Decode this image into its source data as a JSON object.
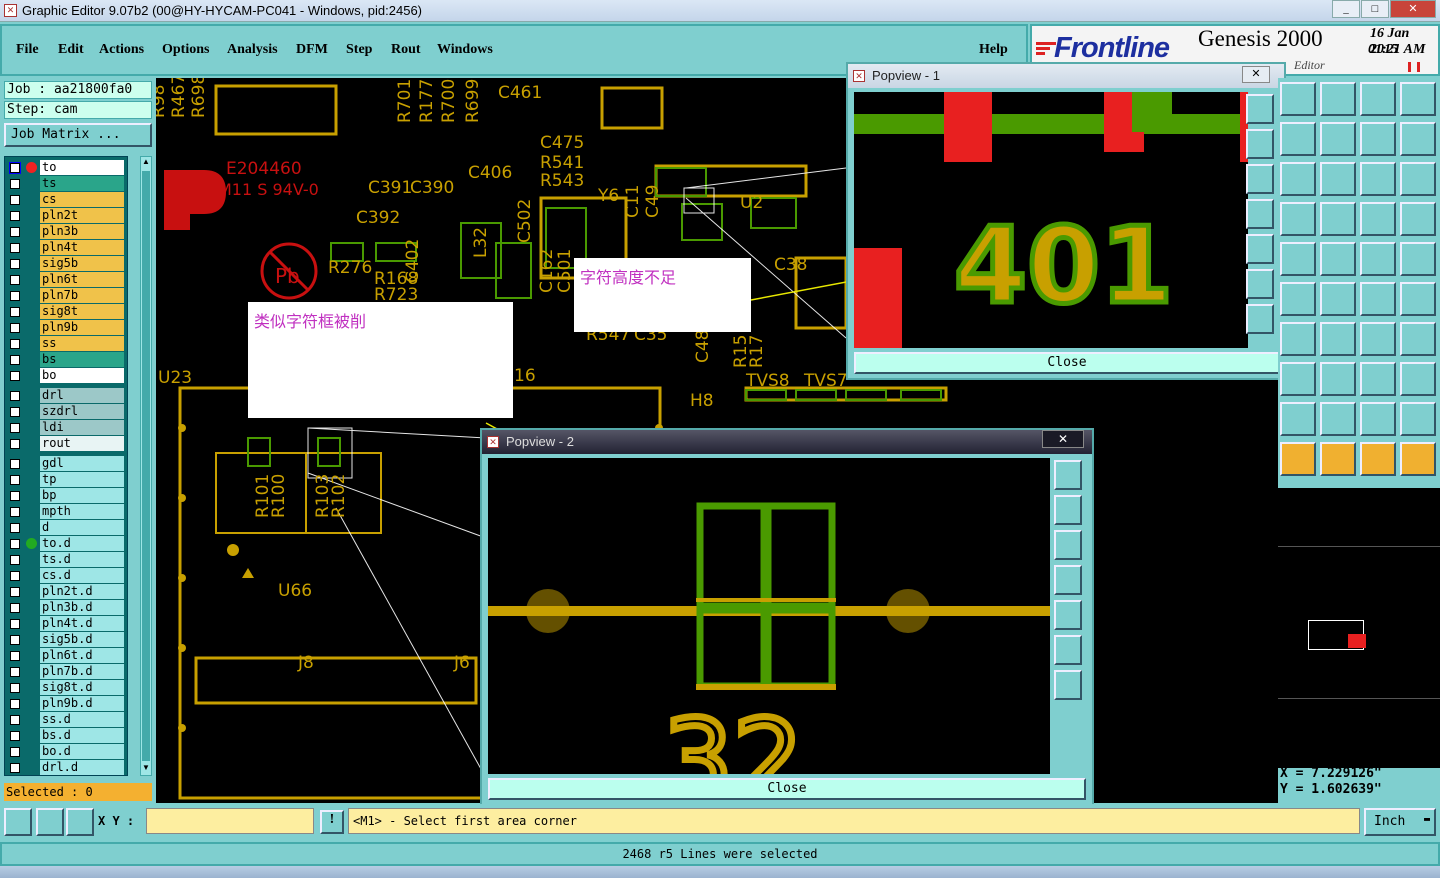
{
  "window": {
    "title": "Graphic Editor 9.07b2 (00@HY-HYCAM-PC041 - Windows, pid:2456)",
    "min": "_",
    "max": "□",
    "close": "✕"
  },
  "menu": {
    "file": "File",
    "edit": "Edit",
    "actions": "Actions",
    "options": "Options",
    "analysis": "Analysis",
    "dfm": "DFM",
    "step": "Step",
    "rout": "Rout",
    "windows": "Windows",
    "help": "Help"
  },
  "brand": {
    "logo": "Frontline",
    "product": "Genesis 2000",
    "date": "16 Jan 2015",
    "time": "01:21 AM",
    "subtitle": "Editor"
  },
  "job": {
    "job_label": "Job : aa21800fa0",
    "step_label": "Step: cam",
    "matrix_button": "Job Matrix ..."
  },
  "layers": [
    {
      "name": "to",
      "color": "#ffffff"
    },
    {
      "name": "ts",
      "color": "#2aa58a"
    },
    {
      "name": "cs",
      "color": "#f0c24a"
    },
    {
      "name": "pln2t",
      "color": "#f0c24a"
    },
    {
      "name": "pln3b",
      "color": "#f0c24a"
    },
    {
      "name": "pln4t",
      "color": "#f0c24a"
    },
    {
      "name": "sig5b",
      "color": "#f0c24a"
    },
    {
      "name": "pln6t",
      "color": "#f0c24a"
    },
    {
      "name": "pln7b",
      "color": "#f0c24a"
    },
    {
      "name": "sig8t",
      "color": "#f0c24a"
    },
    {
      "name": "pln9b",
      "color": "#f0c24a"
    },
    {
      "name": "ss",
      "color": "#f0c24a"
    },
    {
      "name": "bs",
      "color": "#2aa58a"
    },
    {
      "name": "bo",
      "color": "#ffffff"
    },
    {
      "name": "drl",
      "color": "#9cc8c8"
    },
    {
      "name": "szdrl",
      "color": "#9cc8c8"
    },
    {
      "name": "ldi",
      "color": "#9cc8c8"
    },
    {
      "name": "rout",
      "color": "#e8f4f4"
    },
    {
      "name": "gdl",
      "color": "#9ee6e6"
    },
    {
      "name": "tp",
      "color": "#9ee6e6"
    },
    {
      "name": "bp",
      "color": "#9ee6e6"
    },
    {
      "name": "mpth",
      "color": "#9ee6e6"
    },
    {
      "name": "d",
      "color": "#9ee6e6"
    },
    {
      "name": "to.d",
      "color": "#9ee6e6"
    },
    {
      "name": "ts.d",
      "color": "#9ee6e6"
    },
    {
      "name": "cs.d",
      "color": "#9ee6e6"
    },
    {
      "name": "pln2t.d",
      "color": "#9ee6e6"
    },
    {
      "name": "pln3b.d",
      "color": "#9ee6e6"
    },
    {
      "name": "pln4t.d",
      "color": "#9ee6e6"
    },
    {
      "name": "sig5b.d",
      "color": "#9ee6e6"
    },
    {
      "name": "pln6t.d",
      "color": "#9ee6e6"
    },
    {
      "name": "pln7b.d",
      "color": "#9ee6e6"
    },
    {
      "name": "sig8t.d",
      "color": "#9ee6e6"
    },
    {
      "name": "pln9b.d",
      "color": "#9ee6e6"
    },
    {
      "name": "ss.d",
      "color": "#9ee6e6"
    },
    {
      "name": "bs.d",
      "color": "#9ee6e6"
    },
    {
      "name": "bo.d",
      "color": "#9ee6e6"
    },
    {
      "name": "drl.d",
      "color": "#9ee6e6"
    }
  ],
  "selected": "Selected : 0",
  "canvas_labels": {
    "refs_top": [
      "R98",
      "R467",
      "R698",
      "R701",
      "R177",
      "R700",
      "R699",
      "C461",
      "C475",
      "R541",
      "R543",
      "C406",
      "C391",
      "C390",
      "C392",
      "C502",
      "L32",
      "C402",
      "R276",
      "R168",
      "R723",
      "Y6",
      "C11",
      "C49",
      "U2",
      "C38",
      "C162",
      "C501",
      "R547",
      "C35",
      "C48",
      "R15",
      "R17",
      "TVS8",
      "TVS7",
      "H8",
      "U23",
      "16",
      "R101",
      "R100",
      "R103",
      "R102",
      "U66",
      "J8",
      "J6"
    ],
    "ul_mark": "E204460",
    "ul_text": "M11 S 94V-0",
    "pb": "Pb"
  },
  "notes": {
    "note1": "字符高度不足",
    "note2": "类似字符框被削"
  },
  "popup1": {
    "title": "Popview - 1",
    "close_label": "Close",
    "close_x": "✕",
    "zoom_text": "401"
  },
  "popup2": {
    "title": "Popview - 2",
    "close_label": "Close",
    "close_x": "✕",
    "zoom_text": "32"
  },
  "coords": {
    "x": "X = 7.229126\"",
    "y": "Y = 1.602639\""
  },
  "status": {
    "xy_label": "X Y :",
    "xy_value": "",
    "prompt": "<M1> - Select first area corner",
    "units": "Inch",
    "message": "2468 r5 Lines were selected",
    "warn": "!"
  },
  "colors": {
    "cyan_bg": "#7fcfcf",
    "pcb_yellow": "#c8a000",
    "pcb_green": "#4a9a00",
    "pcb_red": "#e82020",
    "note_pink": "#c030c0"
  }
}
